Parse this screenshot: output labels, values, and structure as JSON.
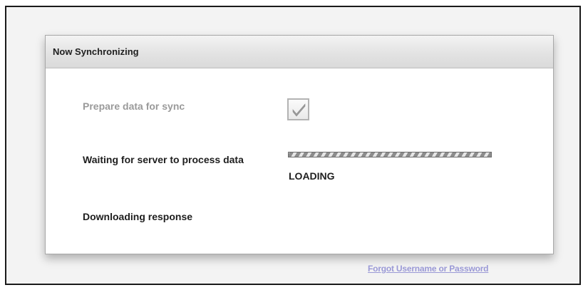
{
  "panel": {
    "title": "Now Synchronizing"
  },
  "steps": [
    {
      "label": "Prepare data for sync",
      "status": "done"
    },
    {
      "label": "Waiting for server to process data",
      "status": "in-progress"
    },
    {
      "label": "Downloading response",
      "status": "pending"
    }
  ],
  "progress": {
    "status_text": "LOADING",
    "fill_fraction": 1.0
  },
  "icons": {
    "step_done": "checkmark-icon"
  },
  "colors": {
    "link": "#9a99d6",
    "done_text": "#9a9a9a"
  },
  "footer": {
    "forgot_link": "Forgot Username or Password"
  }
}
